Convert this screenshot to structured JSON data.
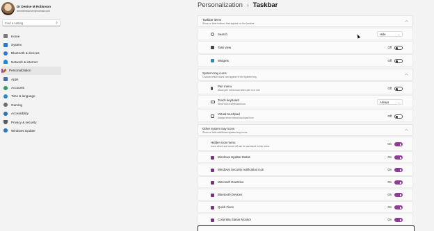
{
  "profile": {
    "name": "Dr Denise M Robinson",
    "email": "drmeltenbacher@hotmail.com"
  },
  "search": {
    "placeholder": "Find a setting"
  },
  "nav": [
    {
      "label": "Home",
      "color": "#7a7a7a"
    },
    {
      "label": "System",
      "color": "#2b79d6"
    },
    {
      "label": "Bluetooth & devices",
      "color": "#2b79d6"
    },
    {
      "label": "Network & internet",
      "color": "#1f88d8"
    },
    {
      "label": "Personalization",
      "color": "#c0602a"
    },
    {
      "label": "Apps",
      "color": "#4a6ea8"
    },
    {
      "label": "Accounts",
      "color": "#2f9d5c"
    },
    {
      "label": "Time & language",
      "color": "#2a88c8"
    },
    {
      "label": "Gaming",
      "color": "#6a6a6a"
    },
    {
      "label": "Accessibility",
      "color": "#2a6fc0"
    },
    {
      "label": "Privacy & security",
      "color": "#5a5a5a"
    },
    {
      "label": "Windows Update",
      "color": "#1f78c8"
    }
  ],
  "header": {
    "crumb": "Personalization",
    "separator": "›",
    "page": "Taskbar"
  },
  "sections": {
    "taskbar_items": {
      "title": "Taskbar items",
      "subtitle": "Show or hide buttons that appear on the taskbar"
    },
    "system_tray": {
      "title": "System tray icons",
      "subtitle": "Choose which icons can appear in the system tray"
    },
    "other_tray": {
      "title": "Other system tray icons",
      "subtitle": "Show or hide additional system tray icons"
    }
  },
  "rows": {
    "search": {
      "label": "Search",
      "value": "Hide"
    },
    "task_view": {
      "label": "Task view",
      "state": "Off"
    },
    "widgets": {
      "label": "Widgets",
      "state": "Off"
    },
    "pen_menu": {
      "label": "Pen menu",
      "sub": "Show pen menu icon when pen is in use",
      "state": "Off"
    },
    "touch_keyboard": {
      "label": "Touch keyboard",
      "sub": "Show touch keyboard icon",
      "value": "Always"
    },
    "virtual_touchpad": {
      "label": "Virtual touchpad",
      "sub": "Always show virtual touchpad icon",
      "state": "Off"
    },
    "hidden_icon_menu": {
      "label": "Hidden icon menu",
      "sub": "Icons which are turned off can be accessed in this menu",
      "state": "On"
    },
    "windows_update_status": {
      "label": "Windows Update Status",
      "state": "On"
    },
    "security_notification": {
      "label": "Windows Security notification icon",
      "state": "On"
    },
    "onedrive": {
      "label": "Microsoft OneDrive",
      "state": "On"
    },
    "bluetooth": {
      "label": "Bluetooth Devices",
      "state": "On"
    },
    "quick_fixes": {
      "label": "Quick Fixes",
      "state": "On"
    },
    "columbia": {
      "label": "Columbia Status Monitor",
      "state": "On"
    }
  },
  "icons": {
    "search_icon": "⌕",
    "chevron_up": "︿",
    "chevron_down": "⌄"
  }
}
